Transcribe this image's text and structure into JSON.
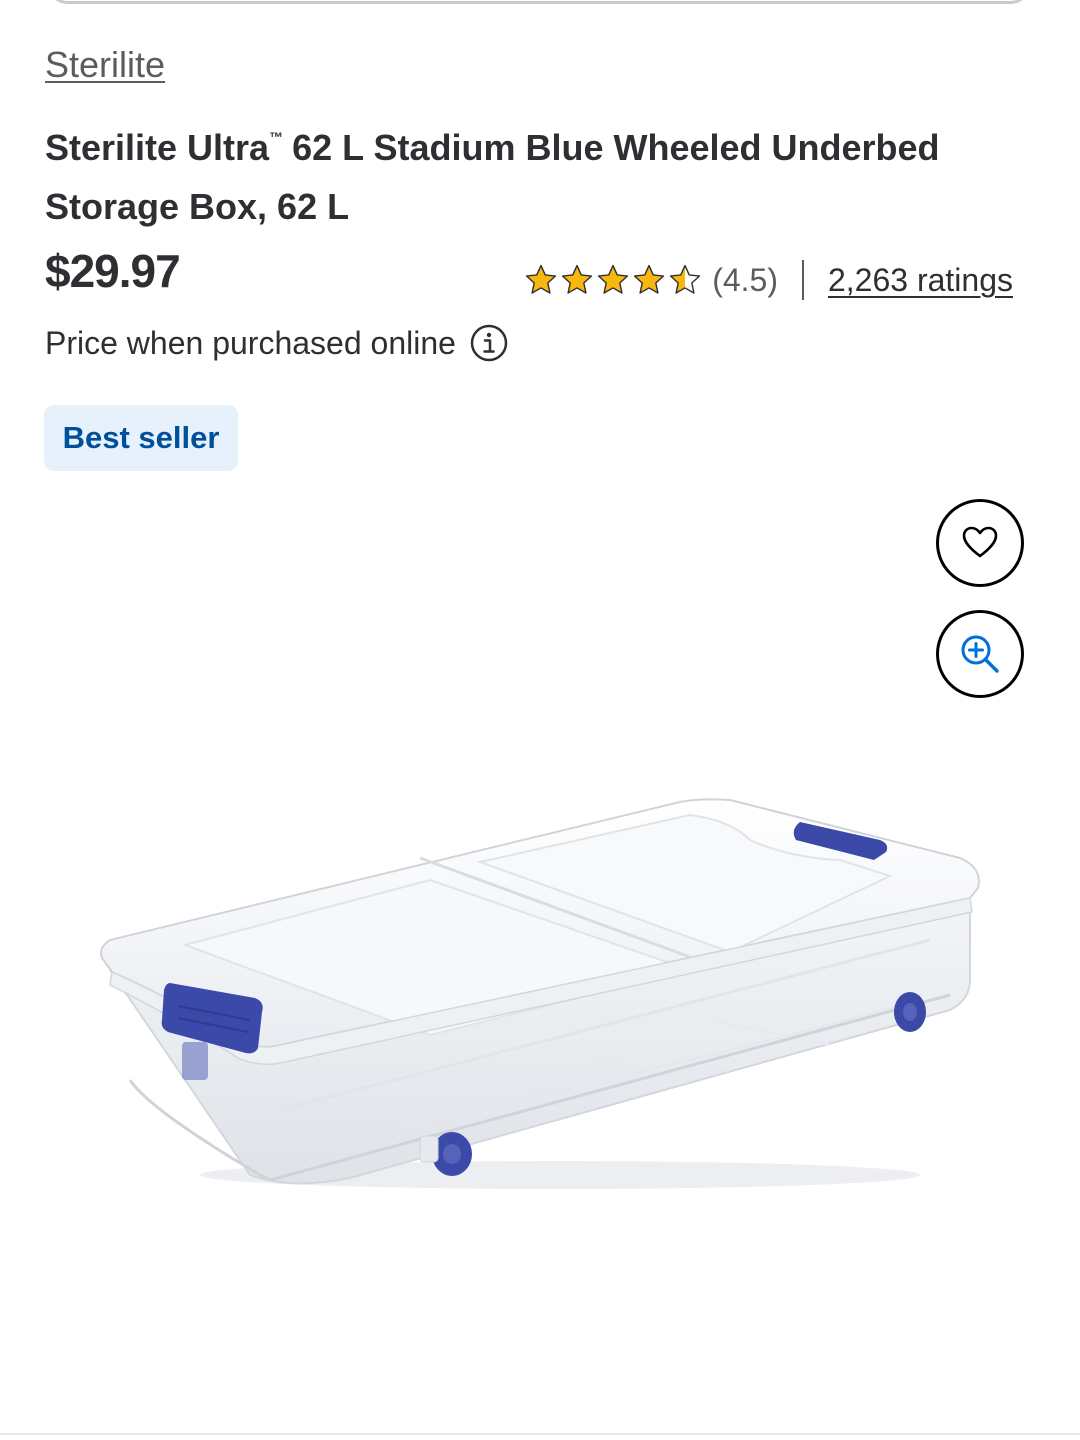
{
  "product": {
    "brand": "Sterilite",
    "title_main": "Sterilite Ultra",
    "title_tm": "™",
    "title_rest": " 62 L Stadium Blue Wheeled Underbed Storage Box, 62 L",
    "price": "$29.97",
    "price_note": "Price when purchased online",
    "badge": "Best seller"
  },
  "rating": {
    "stars": 4.5,
    "value_text": "(4.5)",
    "count_text": "2,263 ratings",
    "star_color": "#f8b70f"
  },
  "icons": {
    "info": "info-icon",
    "favorite": "heart-icon",
    "zoom": "zoom-in-icon",
    "star": "star-icon"
  },
  "colors": {
    "badge_bg": "#e6f1fc",
    "badge_text": "#004f9a",
    "handle_blue": "#3b4aa8"
  }
}
